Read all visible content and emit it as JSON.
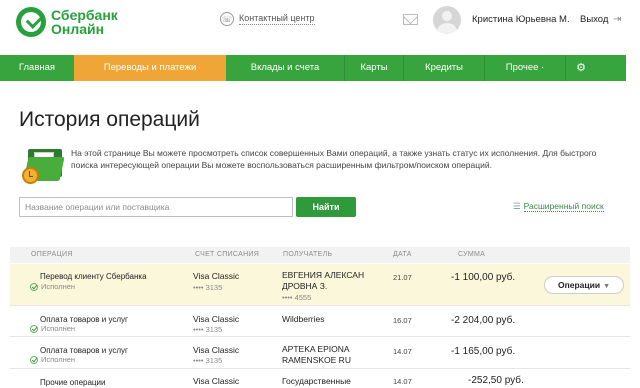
{
  "header": {
    "logo_line1": "Сбербанк",
    "logo_line2": "Онлайн",
    "contact_label": "Контактный центр",
    "user_name": "Кристина Юрьевна М.",
    "logout_label": "Выход"
  },
  "nav": {
    "items": [
      {
        "label": "Главная"
      },
      {
        "label": "Переводы и платежи"
      },
      {
        "label": "Вклады и счета"
      },
      {
        "label": "Карты"
      },
      {
        "label": "Кредиты"
      },
      {
        "label": "Прочее ·"
      }
    ],
    "active_index": 1
  },
  "page": {
    "title": "История операций",
    "intro": "На этой странице Вы можете просмотреть список совершенных Вами операций, а также узнать статус их исполнения. Для быстрого поиска интересующей операции Вы можете воспользоваться расширенным фильтром/поиском операций."
  },
  "search": {
    "placeholder": "Название операции или поставщика",
    "value": "",
    "button_label": "Найти",
    "advanced_label": "Расширенный поиск"
  },
  "table": {
    "headers": {
      "operation": "ОПЕРАЦИЯ",
      "account": "СЧЕТ СПИСАНИЯ",
      "recipient": "ПОЛУЧАТЕЛЬ",
      "date": "ДАТА",
      "amount": "СУММА"
    },
    "rows": [
      {
        "operation": "Перевод клиенту Сбербанка",
        "status": "Исполнен",
        "account": "Visa Classic",
        "account_mask": "•••• 3135",
        "recipient_line1": "ЕВГЕНИЯ АЛЕКСАН",
        "recipient_line2": "ДРОВНА З.",
        "recipient_mask": "•••• 4555",
        "date": "21.07",
        "amount": "-1 100,00 руб.",
        "operations_button": "Операции"
      },
      {
        "operation": "Оплата товаров и услуг",
        "status": "Исполнен",
        "account": "Visa Classic",
        "account_mask": "•••• 3135",
        "recipient_line1": "Wildberries",
        "recipient_line2": "",
        "date": "16.07",
        "amount": "-2 204,00 руб."
      },
      {
        "operation": "Оплата товаров и услуг",
        "status": "Исполнен",
        "account": "Visa Classic",
        "account_mask": "•••• 3135",
        "recipient_line1": "APTEKA EPIONA",
        "recipient_line2": "RAMENSKOE RU",
        "date": "14.07",
        "amount": "-1 165,00 руб."
      },
      {
        "operation": "Прочие операции",
        "status": "",
        "account": "Visa Classic",
        "account_mask": "",
        "recipient_line1": "Государственные",
        "recipient_line2": "",
        "date": "14.07",
        "amount": "-252,50 руб."
      }
    ]
  },
  "colors": {
    "brand_green": "#37a43d",
    "active_tab": "#f0a637",
    "highlight_row": "#fbf7db"
  }
}
